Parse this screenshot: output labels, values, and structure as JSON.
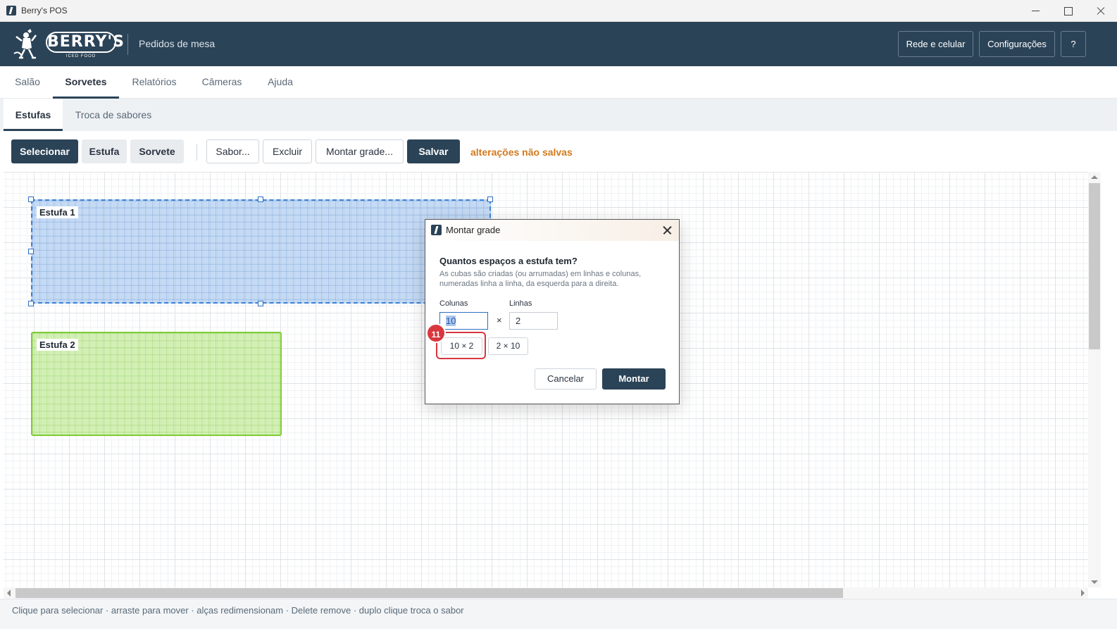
{
  "window": {
    "title": "Berry's POS"
  },
  "header": {
    "logo_text": "BERRY'S",
    "logo_sub": "ICED FOOD",
    "subtitle": "Pedidos de mesa",
    "buttons": {
      "rede": "Rede e celular",
      "config": "Configurações",
      "help": "?"
    }
  },
  "nav": {
    "tabs": [
      "Salão",
      "Sorvetes",
      "Relatórios",
      "Câmeras",
      "Ajuda"
    ],
    "active": "Sorvetes"
  },
  "subnav": {
    "tabs": [
      "Estufas",
      "Troca de sabores"
    ],
    "active": "Estufas"
  },
  "toolbar": {
    "modes": [
      "Selecionar",
      "Estufa",
      "Sorvete"
    ],
    "active_mode": "Selecionar",
    "actions": [
      "Sabor...",
      "Excluir",
      "Montar grade...",
      "Salvar"
    ],
    "unsaved": "alterações não salvas"
  },
  "canvas": {
    "estufas": [
      {
        "label": "Estufa 1",
        "selected": true,
        "color": "#96bceb"
      },
      {
        "label": "Estufa 2",
        "selected": false,
        "color": "#b4e682"
      }
    ]
  },
  "status": {
    "text": "Clique para selecionar · arraste para mover · alças redimensionam · Delete remove · duplo clique troca o sabor"
  },
  "dialog": {
    "title": "Montar grade",
    "question": "Quantos espaços a estufa tem?",
    "description": "As cubas são criadas (ou arrumadas) em linhas e colunas, numeradas linha a linha, da esquerda para a direita.",
    "columns_label": "Colunas",
    "rows_label": "Linhas",
    "columns_value": "10",
    "rows_value": "2",
    "times": "×",
    "presets": [
      "10 × 2",
      "2 × 10"
    ],
    "step_badge": "11",
    "cancel": "Cancelar",
    "confirm": "Montar"
  }
}
